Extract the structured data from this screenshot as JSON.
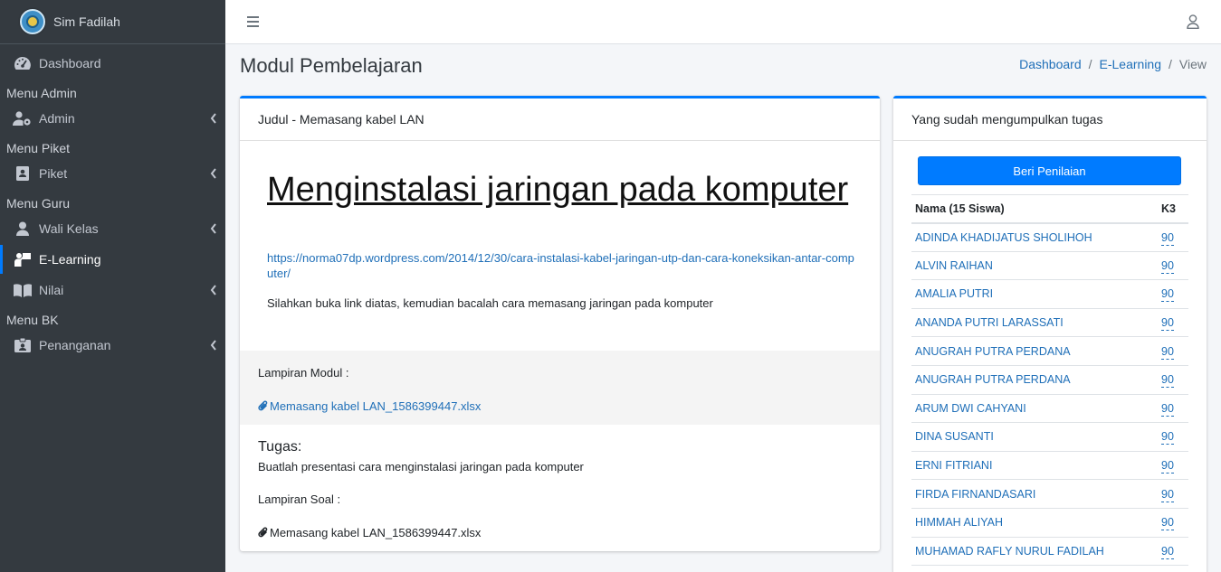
{
  "brand": {
    "name": "Sim Fadilah"
  },
  "sidebar": {
    "dashboard": "Dashboard",
    "header_admin": "Menu Admin",
    "admin": "Admin",
    "header_piket": "Menu Piket",
    "piket": "Piket",
    "header_guru": "Menu Guru",
    "wali_kelas": "Wali Kelas",
    "e_learning": "E-Learning",
    "nilai": "Nilai",
    "header_bk": "Menu BK",
    "penanganan": "Penanganan"
  },
  "page": {
    "title": "Modul Pembelajaran"
  },
  "breadcrumb": {
    "item1": "Dashboard",
    "sep": "/",
    "item2": "E-Learning",
    "current": "View"
  },
  "module": {
    "header": "Judul - Memasang kabel LAN",
    "title": "Menginstalasi jaringan pada komputer",
    "link": "https://norma07dp.wordpress.com/2014/12/30/cara-instalasi-kabel-jaringan-utp-dan-cara-koneksikan-antar-computer/",
    "description": "Silahkan buka link diatas, kemudian bacalah cara memasang jaringan pada komputer",
    "attachment_label": "Lampiran Modul :",
    "attachment_file": "Memasang kabel LAN_1586399447.xlsx",
    "task_label": "Tugas:",
    "task_text": "Buatlah presentasi cara menginstalasi jaringan pada komputer",
    "question_label": "Lampiran Soal :",
    "question_file": "Memasang kabel LAN_1586399447.xlsx"
  },
  "submissions": {
    "header": "Yang sudah mengumpulkan tugas",
    "grade_button": "Beri Penilaian",
    "col_name": "Nama (15 Siswa)",
    "col_score": "K3",
    "rows": [
      {
        "name": "ADINDA KHADIJATUS SHOLIHOH",
        "score": "90"
      },
      {
        "name": "ALVIN RAIHAN",
        "score": "90"
      },
      {
        "name": "AMALIA PUTRI",
        "score": "90"
      },
      {
        "name": "ANANDA PUTRI LARASSATI",
        "score": "90"
      },
      {
        "name": "ANUGRAH PUTRA PERDANA",
        "score": "90"
      },
      {
        "name": "ANUGRAH PUTRA PERDANA",
        "score": "90"
      },
      {
        "name": "ARUM DWI CAHYANI",
        "score": "90"
      },
      {
        "name": "DINA SUSANTI",
        "score": "90"
      },
      {
        "name": "ERNI FITRIANI",
        "score": "90"
      },
      {
        "name": "FIRDA FIRNANDASARI",
        "score": "90"
      },
      {
        "name": "HIMMAH ALIYAH",
        "score": "90"
      },
      {
        "name": "MUHAMAD RAFLY NURUL FADILAH",
        "score": "90"
      }
    ]
  },
  "colors": {
    "sidebar_bg": "#343a40",
    "primary": "#007bff",
    "link": "#1f6fb8"
  }
}
